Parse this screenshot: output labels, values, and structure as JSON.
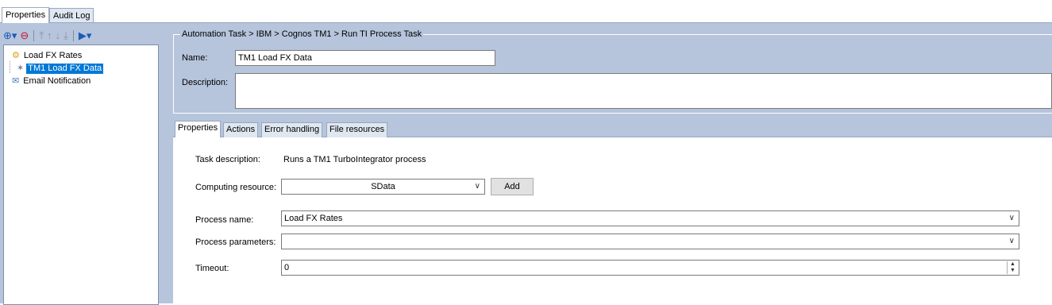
{
  "top_tabs": [
    "Properties",
    "Audit Log"
  ],
  "tree": {
    "items": [
      {
        "label": "Load FX Rates",
        "icon": "task-group-icon"
      },
      {
        "label": "TM1 Load FX Data",
        "icon": "tm1-process-icon",
        "selected": true
      },
      {
        "label": "Email Notification",
        "icon": "email-task-icon"
      }
    ]
  },
  "header": {
    "group_title": "Automation Task > IBM > Cognos TM1 > Run TI Process Task",
    "name_label": "Name:",
    "name_value": "TM1 Load FX Data",
    "description_label": "Description:",
    "description_value": ""
  },
  "inner_tabs": [
    "Properties",
    "Actions",
    "Error handling",
    "File resources"
  ],
  "properties": {
    "task_description_label": "Task description:",
    "task_description_value": "Runs a TM1 TurboIntegrator process",
    "computing_resource_label": "Computing resource:",
    "computing_resource_value": "SData",
    "add_button": "Add",
    "process_name_label": "Process name:",
    "process_name_value": "Load FX Rates",
    "process_parameters_label": "Process parameters:",
    "process_parameters_value": "",
    "timeout_label": "Timeout:",
    "timeout_value": "0"
  }
}
